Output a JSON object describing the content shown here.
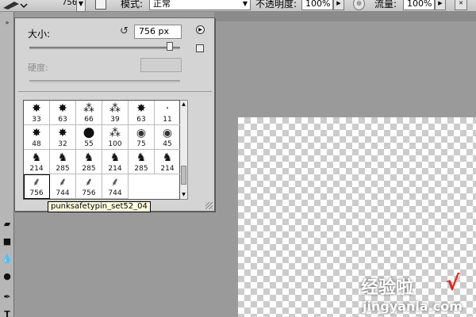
{
  "options_bar": {
    "brush_size": "756",
    "mode_label": "模式:",
    "mode_value": "正常",
    "opacity_label": "不透明度:",
    "opacity_value": "100%",
    "flow_label": "流量:",
    "flow_value": "100%"
  },
  "brush_panel": {
    "size_label": "大小:",
    "size_value": "756 px",
    "size_slider_fraction": 0.93,
    "hardness_label": "硬度:",
    "hardness_value": "",
    "presets": [
      {
        "size": "33",
        "tip": "splatter"
      },
      {
        "size": "63",
        "tip": "splatter"
      },
      {
        "size": "66",
        "tip": "scatter"
      },
      {
        "size": "39",
        "tip": "scatter"
      },
      {
        "size": "63",
        "tip": "splatter"
      },
      {
        "size": "11",
        "tip": "small-dot"
      },
      {
        "size": "48",
        "tip": "splatter"
      },
      {
        "size": "32",
        "tip": "splatter"
      },
      {
        "size": "55",
        "tip": "hard-round"
      },
      {
        "size": "100",
        "tip": "scatter"
      },
      {
        "size": "75",
        "tip": "soft-round"
      },
      {
        "size": "45",
        "tip": "soft-round"
      },
      {
        "size": "214",
        "tip": "horse"
      },
      {
        "size": "285",
        "tip": "horse"
      },
      {
        "size": "285",
        "tip": "horse"
      },
      {
        "size": "214",
        "tip": "horse"
      },
      {
        "size": "285",
        "tip": "horse"
      },
      {
        "size": "214",
        "tip": "horse"
      },
      {
        "size": "756",
        "tip": "feather",
        "selected": true
      },
      {
        "size": "744",
        "tip": "feather"
      },
      {
        "size": "756",
        "tip": "feather"
      },
      {
        "size": "744",
        "tip": "feather"
      }
    ],
    "tooltip": "punksafetypin_set52_04"
  },
  "watermark": {
    "line1": "经验啦",
    "line2": "jingyanla.com",
    "check": "√"
  },
  "colors": {
    "workspace": "#9a9a9a",
    "panel": "#d4d4d4",
    "tooltip_bg": "#ffffe1",
    "checker": "#cccccc",
    "watermark_check": "#e2241b"
  }
}
